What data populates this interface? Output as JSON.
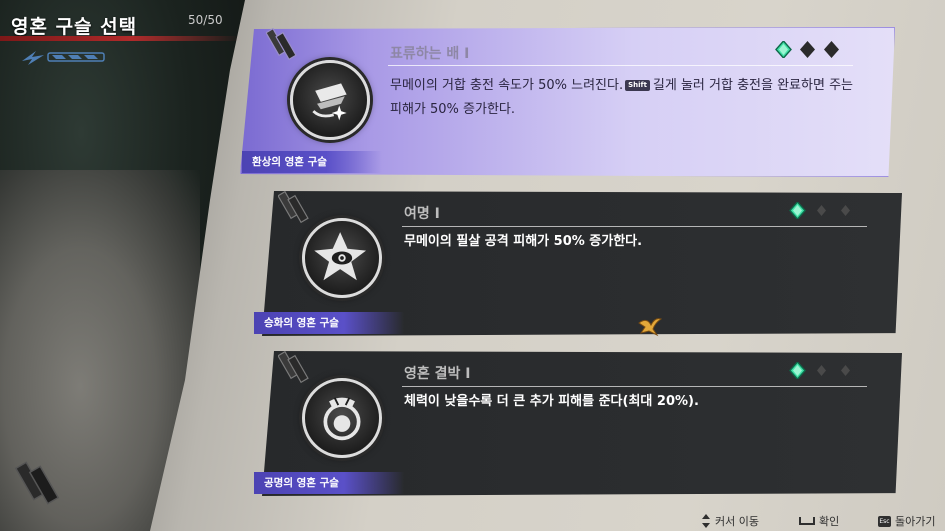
{
  "header": {
    "title": "영혼 구슬 선택",
    "count": "50/50"
  },
  "cards": [
    {
      "title": "표류하는 배 I",
      "desc_before": "무메이의 거합 충전 속도가 50% 느려진다.",
      "key": "Shift",
      "desc_after": "길게 눌러 거합 충전을 완료하면 주는 피해가 50% 증가한다.",
      "category": "환상의 영혼 구슬",
      "emblem_icon": "ship-icon",
      "level": "1 of 3",
      "accent": "#8d7fe0"
    },
    {
      "title": "여명 I",
      "desc": "무메이의 필살 공격 피해가 50% 증가한다.",
      "category": "승화의 영혼 구슬",
      "emblem_icon": "star-eye-icon",
      "level": "1 of 3"
    },
    {
      "title": "영혼 결박 I",
      "desc": "체력이 낮을수록 더 큰 추가 피해를 준다(최대 20%).",
      "category": "공명의 영혼 구슬",
      "emblem_icon": "bound-soul-icon",
      "level": "1 of 3"
    }
  ],
  "footer": {
    "cursor_label": "커서 이동",
    "confirm_label": "확인",
    "back_key": "Esc",
    "back_label": "돌아가기"
  },
  "colors": {
    "gem_active": "#3fe0a6",
    "gem_inactive": "#2b2b2b",
    "ribbon": "#5a50c8",
    "hp_bar": "#b02a2a"
  }
}
